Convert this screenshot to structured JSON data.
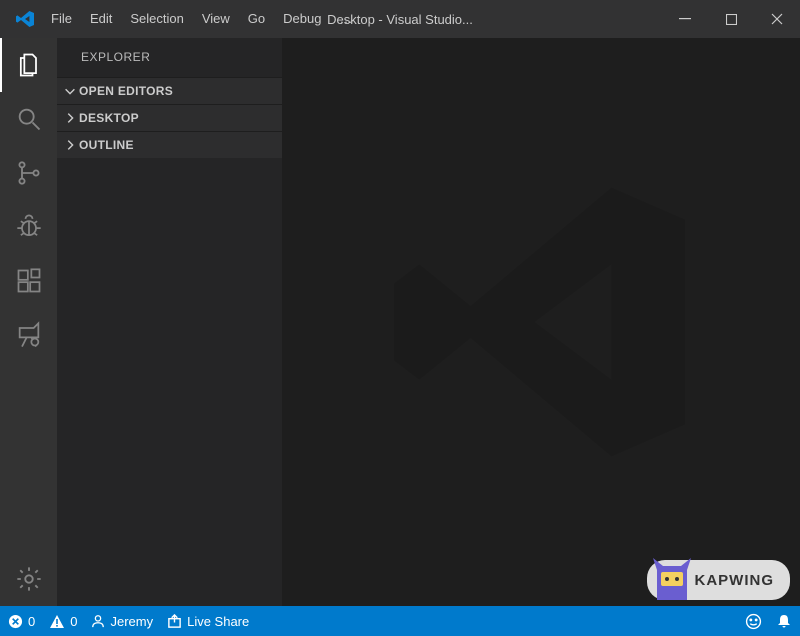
{
  "titlebar": {
    "title": "Desktop - Visual Studio...",
    "menu": [
      "File",
      "Edit",
      "Selection",
      "View",
      "Go",
      "Debug",
      "…"
    ]
  },
  "activity_bar": {
    "items": [
      "explorer-icon",
      "search-icon",
      "source-control-icon",
      "debug-icon",
      "extensions-icon",
      "live-share-icon"
    ],
    "active": 0,
    "bottom": "settings-gear-icon"
  },
  "sidebar": {
    "title": "EXPLORER",
    "sections": [
      {
        "label": "OPEN EDITORS",
        "expanded": true
      },
      {
        "label": "DESKTOP",
        "expanded": false
      },
      {
        "label": "OUTLINE",
        "expanded": false
      }
    ]
  },
  "statusbar": {
    "errors": "0",
    "warnings": "0",
    "user": "Jeremy",
    "live_share": "Live Share"
  },
  "watermark": {
    "brand": "KAPWING"
  }
}
